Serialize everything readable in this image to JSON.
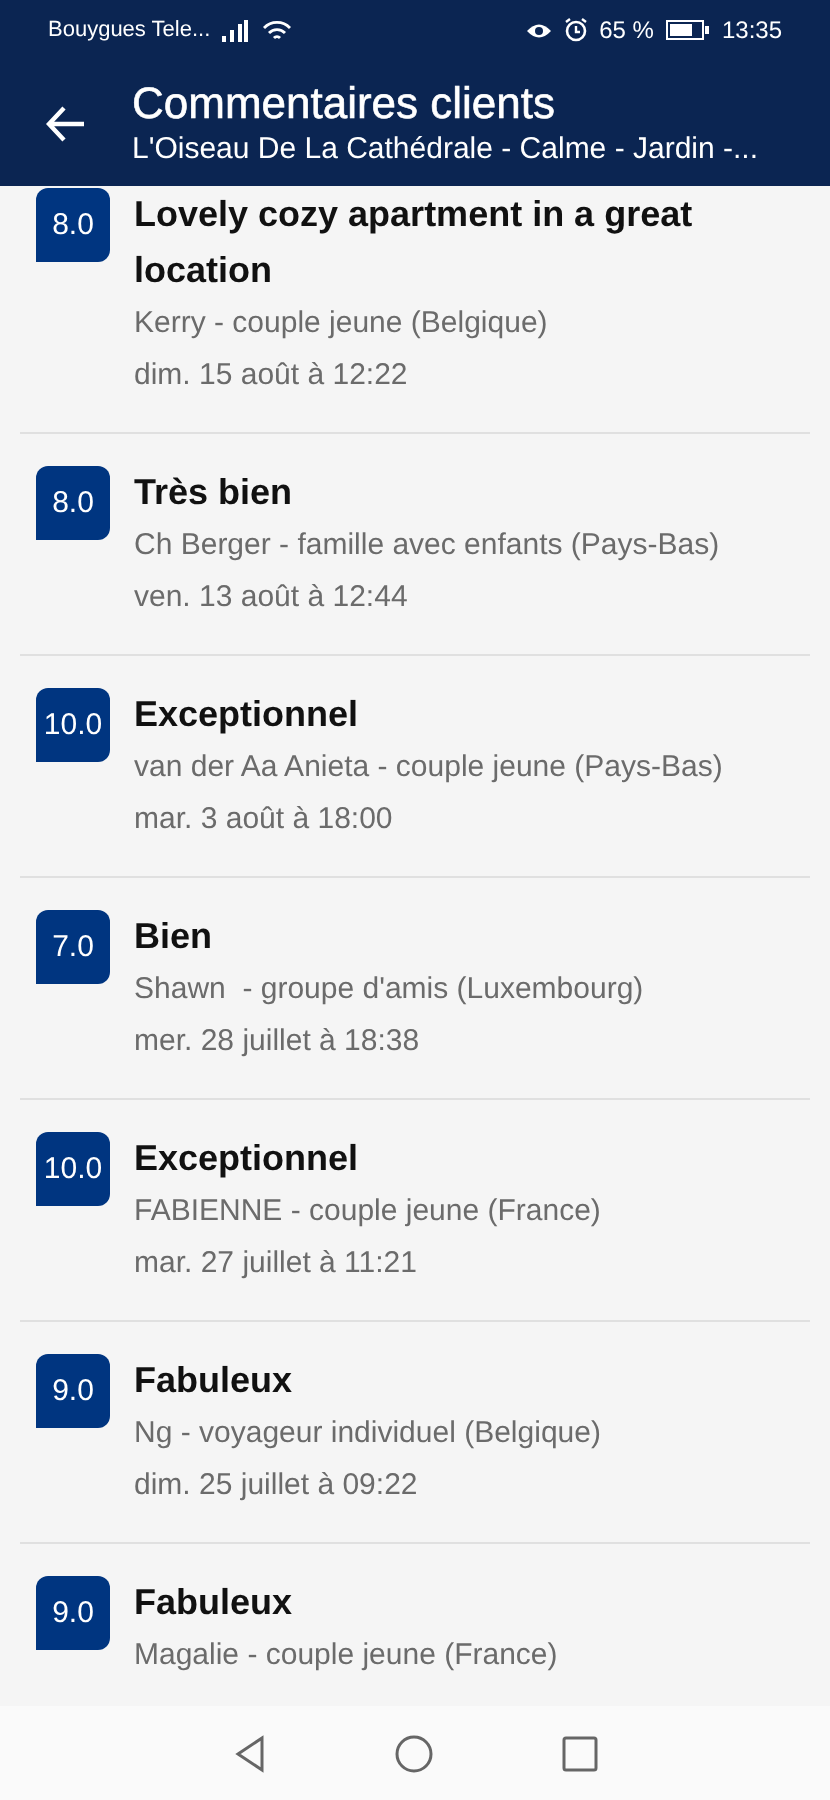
{
  "status_bar": {
    "carrier": "Bouygues Tele...",
    "battery_text": "65 %",
    "time": "13:35"
  },
  "header": {
    "title": "Commentaires clients",
    "subtitle": "L'Oiseau De La Cathédrale - Calme - Jardin -..."
  },
  "reviews": [
    {
      "score": "8.0",
      "title": "Lovely cozy apartment in a great location",
      "author": "Kerry - couple jeune (Belgique)",
      "date": "dim. 15 août à 12:22"
    },
    {
      "score": "8.0",
      "title": "Très bien",
      "author": "Ch Berger - famille avec enfants (Pays-Bas)",
      "date": "ven. 13 août à 12:44"
    },
    {
      "score": "10.0",
      "title": "Exceptionnel",
      "author": "van der Aa Anieta - couple jeune (Pays-Bas)",
      "date": "mar. 3 août à 18:00"
    },
    {
      "score": "7.0",
      "title": "Bien",
      "author": "Shawn  - groupe d'amis (Luxembourg)",
      "date": "mer. 28 juillet à 18:38"
    },
    {
      "score": "10.0",
      "title": "Exceptionnel",
      "author": "FABIENNE - couple jeune (France)",
      "date": "mar. 27 juillet à 11:21"
    },
    {
      "score": "9.0",
      "title": "Fabuleux",
      "author": "Ng - voyageur individuel (Belgique)",
      "date": "dim. 25 juillet à 09:22"
    },
    {
      "score": "9.0",
      "title": "Fabuleux",
      "author": "Magalie - couple jeune (France)"
    }
  ]
}
